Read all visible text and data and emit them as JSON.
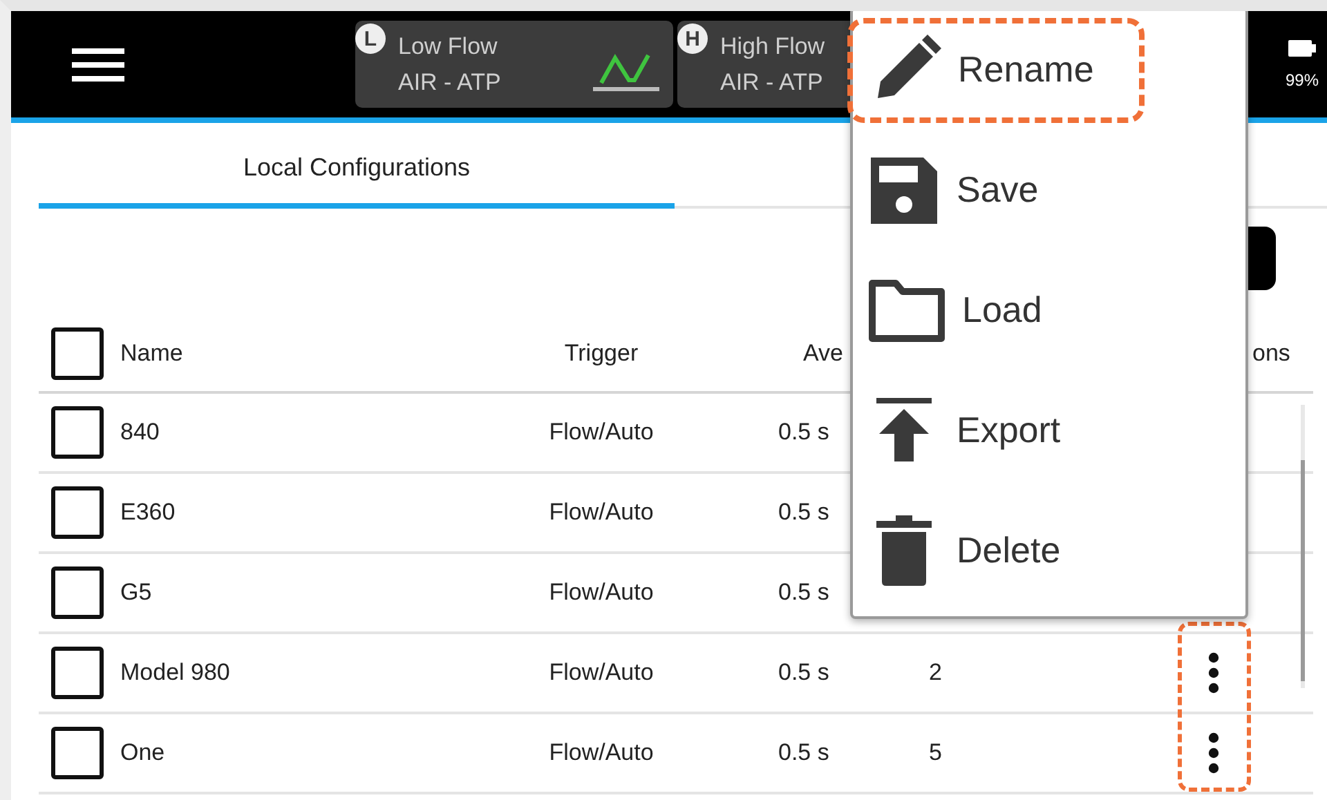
{
  "top_bar": {
    "mode_cards": [
      {
        "badge": "L",
        "title": "Low Flow",
        "subtitle": "AIR - ATP",
        "waveform": true
      },
      {
        "badge": "H",
        "title": "High Flow",
        "subtitle": "AIR - ATP"
      }
    ],
    "battery": "99%"
  },
  "tabs": [
    {
      "label": "Local Configurations",
      "selected": true
    }
  ],
  "table": {
    "header": {
      "name": "Name",
      "trigger": "Trigger",
      "column_3": "Ave",
      "column_5": "ons",
      "checked": false
    },
    "actions_highlighted": true,
    "rows": [
      {
        "name": "840",
        "trigger": "Flow/Auto",
        "column_3": "0.5 s",
        "checked": false
      },
      {
        "name": "E360",
        "trigger": "Flow/Auto",
        "column_3": "0.5 s",
        "checked": false
      },
      {
        "name": "G5",
        "trigger": "Flow/Auto",
        "column_3": "0.5 s",
        "checked": false
      },
      {
        "name": "Model 980",
        "trigger": "Flow/Auto",
        "column_3": "0.5 s",
        "column_4": "2",
        "checked": false,
        "actions_menu": true
      },
      {
        "name": "One",
        "trigger": "Flow/Auto",
        "column_3": "0.5 s",
        "column_4": "5",
        "checked": false,
        "actions_menu": true
      }
    ]
  },
  "context_menu": {
    "items": [
      {
        "kind": "rename",
        "label": "Rename",
        "highlighted": true
      },
      {
        "kind": "save",
        "label": "Save",
        "highlighted": false
      },
      {
        "kind": "load",
        "label": "Load",
        "highlighted": false
      },
      {
        "kind": "export",
        "label": "Export",
        "highlighted": false
      },
      {
        "kind": "delete",
        "label": "Delete",
        "highlighted": false
      }
    ]
  }
}
